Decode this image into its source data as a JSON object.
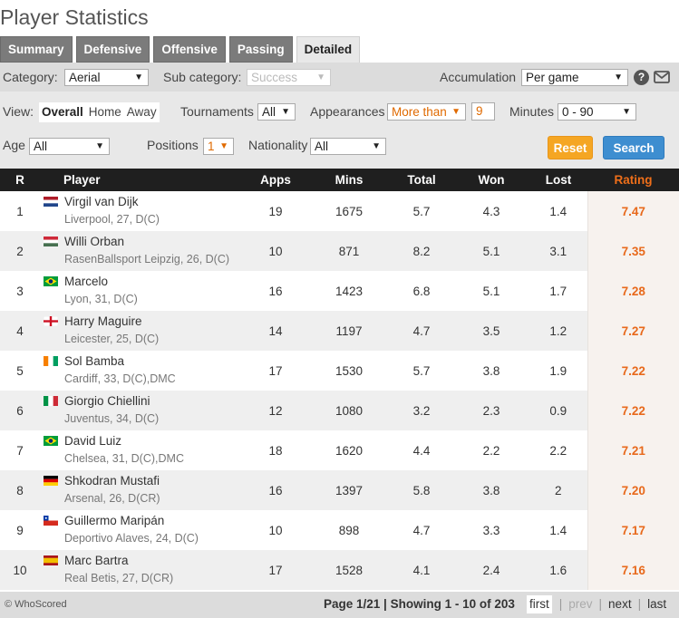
{
  "page_title": "Player Statistics",
  "tabs": [
    "Summary",
    "Defensive",
    "Offensive",
    "Passing",
    "Detailed"
  ],
  "active_tab": "Detailed",
  "filters": {
    "category_label": "Category:",
    "category_value": "Aerial",
    "subcategory_label": "Sub category:",
    "subcategory_value": "Success",
    "accumulation_label": "Accumulation",
    "accumulation_value": "Per game",
    "help_icon": "?",
    "view_label": "View:",
    "view_options": [
      "Overall",
      "Home",
      "Away"
    ],
    "view_selected": "Overall",
    "tournaments_label": "Tournaments",
    "tournaments_value": "All",
    "appearances_label": "Appearances",
    "appearances_value": "More than",
    "appearances_number": "9",
    "minutes_label": "Minutes",
    "minutes_value": "0 - 90",
    "age_label": "Age",
    "age_value": "All",
    "positions_label": "Positions",
    "positions_value": "1",
    "nationality_label": "Nationality",
    "nationality_value": "All",
    "reset_label": "Reset",
    "search_label": "Search"
  },
  "table": {
    "headers": [
      "R",
      "Player",
      "Apps",
      "Mins",
      "Total",
      "Won",
      "Lost",
      "Rating"
    ],
    "rows": [
      {
        "rank": "1",
        "flag": "netherlands",
        "name": "Virgil van Dijk",
        "meta": "Liverpool, 27, D(C)",
        "apps": "19",
        "mins": "1675",
        "total": "5.7",
        "won": "4.3",
        "lost": "1.4",
        "rating": "7.47"
      },
      {
        "rank": "2",
        "flag": "hungary",
        "name": "Willi Orban",
        "meta": "RasenBallsport Leipzig, 26, D(C)",
        "apps": "10",
        "mins": "871",
        "total": "8.2",
        "won": "5.1",
        "lost": "3.1",
        "rating": "7.35"
      },
      {
        "rank": "3",
        "flag": "brazil",
        "name": "Marcelo",
        "meta": "Lyon, 31, D(C)",
        "apps": "16",
        "mins": "1423",
        "total": "6.8",
        "won": "5.1",
        "lost": "1.7",
        "rating": "7.28"
      },
      {
        "rank": "4",
        "flag": "england",
        "name": "Harry Maguire",
        "meta": "Leicester, 25, D(C)",
        "apps": "14",
        "mins": "1197",
        "total": "4.7",
        "won": "3.5",
        "lost": "1.2",
        "rating": "7.27"
      },
      {
        "rank": "5",
        "flag": "ivory-coast",
        "name": "Sol Bamba",
        "meta": "Cardiff, 33, D(C),DMC",
        "apps": "17",
        "mins": "1530",
        "total": "5.7",
        "won": "3.8",
        "lost": "1.9",
        "rating": "7.22"
      },
      {
        "rank": "6",
        "flag": "italy",
        "name": "Giorgio Chiellini",
        "meta": "Juventus, 34, D(C)",
        "apps": "12",
        "mins": "1080",
        "total": "3.2",
        "won": "2.3",
        "lost": "0.9",
        "rating": "7.22"
      },
      {
        "rank": "7",
        "flag": "brazil",
        "name": "David Luiz",
        "meta": "Chelsea, 31, D(C),DMC",
        "apps": "18",
        "mins": "1620",
        "total": "4.4",
        "won": "2.2",
        "lost": "2.2",
        "rating": "7.21"
      },
      {
        "rank": "8",
        "flag": "germany",
        "name": "Shkodran Mustafi",
        "meta": "Arsenal, 26, D(CR)",
        "apps": "16",
        "mins": "1397",
        "total": "5.8",
        "won": "3.8",
        "lost": "2",
        "rating": "7.20"
      },
      {
        "rank": "9",
        "flag": "chile",
        "name": "Guillermo Maripán",
        "meta": "Deportivo Alaves, 24, D(C)",
        "apps": "10",
        "mins": "898",
        "total": "4.7",
        "won": "3.3",
        "lost": "1.4",
        "rating": "7.17"
      },
      {
        "rank": "10",
        "flag": "spain",
        "name": "Marc Bartra",
        "meta": "Real Betis, 27, D(CR)",
        "apps": "17",
        "mins": "1528",
        "total": "4.1",
        "won": "2.4",
        "lost": "1.6",
        "rating": "7.16"
      }
    ]
  },
  "footer": {
    "copyright": "© WhoScored",
    "page_info": "Page 1/21 | Showing 1 - 10 of 203",
    "first": "first",
    "prev": "prev",
    "next": "next",
    "last": "last",
    "separator": "|"
  },
  "colors": {
    "tab_bg": "#7b7b7b",
    "header_bg": "#1f1f1f",
    "rating": "#e8691b",
    "reset_btn": "#f5a623",
    "search_btn": "#3e8ed0"
  }
}
